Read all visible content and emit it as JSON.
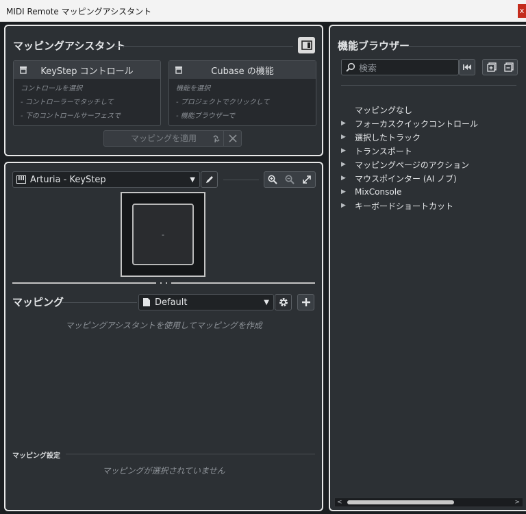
{
  "window": {
    "title": "MIDI Remote マッピングアシスタント",
    "close_label": "x"
  },
  "assistant": {
    "title": "マッピングアシスタント",
    "left_card": {
      "title": "KeyStep コントロール",
      "lines": [
        "コントロールを選択",
        "- コントローラーでタッチして",
        "- 下のコントロールサーフェスで"
      ]
    },
    "right_card": {
      "title": "Cubase の機能",
      "lines": [
        "機能を選択",
        "- プロジェクトでクリックして",
        "- 機能ブラウザーで"
      ]
    },
    "apply_label": "マッピングを適用"
  },
  "surface": {
    "device_name": "Arturia - KeyStep",
    "pad_label": "-"
  },
  "mapping": {
    "title": "マッピング",
    "page_name": "Default",
    "empty_hint": "マッピングアシスタントを使用してマッピングを作成",
    "settings_title": "マッピング設定",
    "settings_empty": "マッピングが選択されていません"
  },
  "browser": {
    "title": "機能ブラウザー",
    "search_placeholder": "検索",
    "items": [
      {
        "label": "マッピングなし",
        "expandable": false
      },
      {
        "label": "フォーカスクイックコントロール",
        "expandable": true
      },
      {
        "label": "選択したトラック",
        "expandable": true
      },
      {
        "label": "トランスポート",
        "expandable": true
      },
      {
        "label": "マッピングページのアクション",
        "expandable": true
      },
      {
        "label": "マウスポインター (AI ノブ)",
        "expandable": true
      },
      {
        "label": "MixConsole",
        "expandable": true
      },
      {
        "label": "キーボードショートカット",
        "expandable": true
      }
    ]
  },
  "colors": {
    "panel": "#2c3034",
    "border": "#e8e8e8",
    "background": "#1b1e21"
  }
}
